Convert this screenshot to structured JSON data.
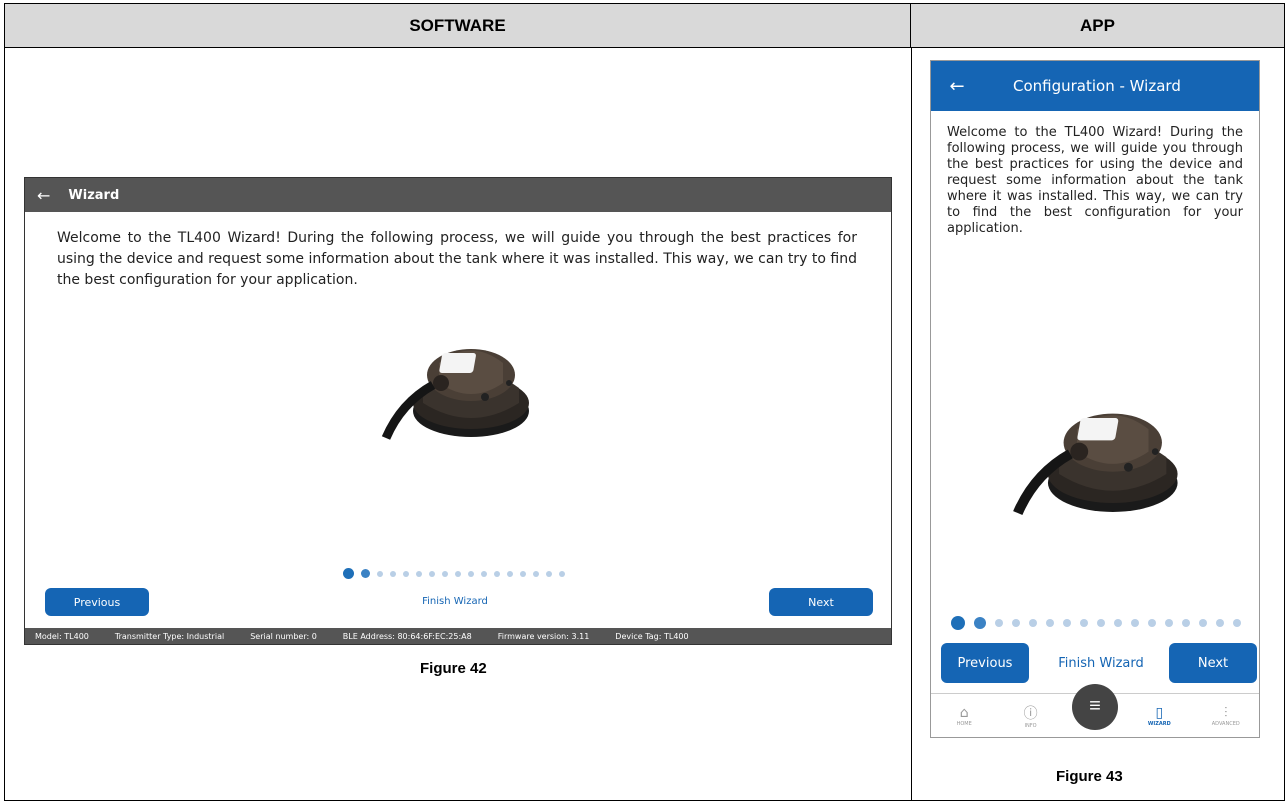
{
  "header": {
    "software_label": "SOFTWARE",
    "app_label": "APP"
  },
  "software": {
    "window_title": "Wizard",
    "intro_text": "Welcome to the TL400 Wizard! During the following process, we will guide you through the best practices for using the device and request some information about the tank where it was installed. This way, we can try to find the best configuration for your application.",
    "previous_label": "Previous",
    "finish_label": "Finish Wizard",
    "next_label": "Next",
    "status": {
      "model": "Model: TL400",
      "transmitter_type": "Transmitter Type: Industrial",
      "serial": "Serial number: 0",
      "ble": "BLE Address: 80:64:6F:EC:25:A8",
      "firmware": "Firmware version: 3.11",
      "tag": "Device Tag: TL400"
    },
    "caption": "Figure 42",
    "page_count": 17,
    "current_page": 1
  },
  "app": {
    "title": "Configuration - Wizard",
    "intro_text": "Welcome to the TL400 Wizard! During the following process, we will guide you through the best practices for using the device and request some information about the tank where it was installed. This way, we can try to find the best configuration for your application.",
    "previous_label": "Previous",
    "finish_label": "Finish Wizard",
    "next_label": "Next",
    "nav": {
      "home": "HOME",
      "info": "INFO",
      "wizard": "WIZARD",
      "advanced": "ADVANCED"
    },
    "caption": "Figure 43",
    "page_count": 17,
    "current_page": 1
  },
  "colors": {
    "accent": "#1565b4",
    "titlebar": "#555555",
    "dot_inactive": "#b9cfe6"
  }
}
